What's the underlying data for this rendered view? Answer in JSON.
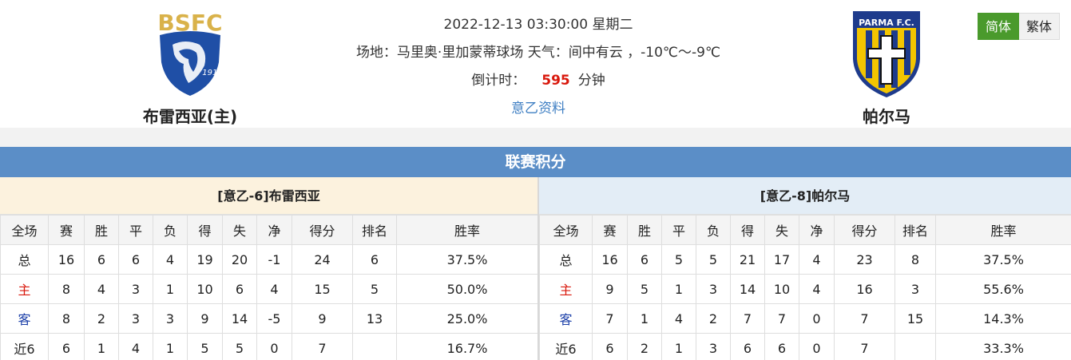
{
  "match": {
    "datetime": "2022-12-13 03:30:00 星期二",
    "venue_weather": "场地：马里奥·里加蒙蒂球场 天气：间中有云 ，-10℃～-9℃",
    "countdown_label": "倒计时：",
    "countdown_value": "595",
    "countdown_unit": "分钟",
    "league_link": "意乙资料"
  },
  "home_team": {
    "name": "布雷西亚(主)",
    "logo_text": "BSFC",
    "logo_year": "1911",
    "logo_color": "#1f4fa6"
  },
  "away_team": {
    "name": "帕尔马",
    "logo_text": "PARMA F.C.",
    "logo_color": "#f2c500"
  },
  "lang": {
    "simplified": "简体",
    "traditional": "繁体"
  },
  "standings": {
    "title": "联赛积分",
    "columns": [
      "全场",
      "赛",
      "胜",
      "平",
      "负",
      "得",
      "失",
      "净",
      "得分",
      "排名",
      "胜率"
    ],
    "home": {
      "title": "[意乙-6]布雷西亚",
      "rows": [
        [
          "总",
          "16",
          "6",
          "6",
          "4",
          "19",
          "20",
          "-1",
          "24",
          "6",
          "37.5%"
        ],
        [
          "主",
          "8",
          "4",
          "3",
          "1",
          "10",
          "6",
          "4",
          "15",
          "5",
          "50.0%"
        ],
        [
          "客",
          "8",
          "2",
          "3",
          "3",
          "9",
          "14",
          "-5",
          "9",
          "13",
          "25.0%"
        ],
        [
          "近6",
          "6",
          "1",
          "4",
          "1",
          "5",
          "5",
          "0",
          "7",
          "",
          "16.7%"
        ]
      ]
    },
    "away": {
      "title": "[意乙-8]帕尔马",
      "rows": [
        [
          "总",
          "16",
          "6",
          "5",
          "5",
          "21",
          "17",
          "4",
          "23",
          "8",
          "37.5%"
        ],
        [
          "主",
          "9",
          "5",
          "1",
          "3",
          "14",
          "10",
          "4",
          "16",
          "3",
          "55.6%"
        ],
        [
          "客",
          "7",
          "1",
          "4",
          "2",
          "7",
          "7",
          "0",
          "7",
          "15",
          "14.3%"
        ],
        [
          "近6",
          "6",
          "2",
          "1",
          "3",
          "6",
          "6",
          "0",
          "7",
          "",
          "33.3%"
        ]
      ]
    }
  }
}
